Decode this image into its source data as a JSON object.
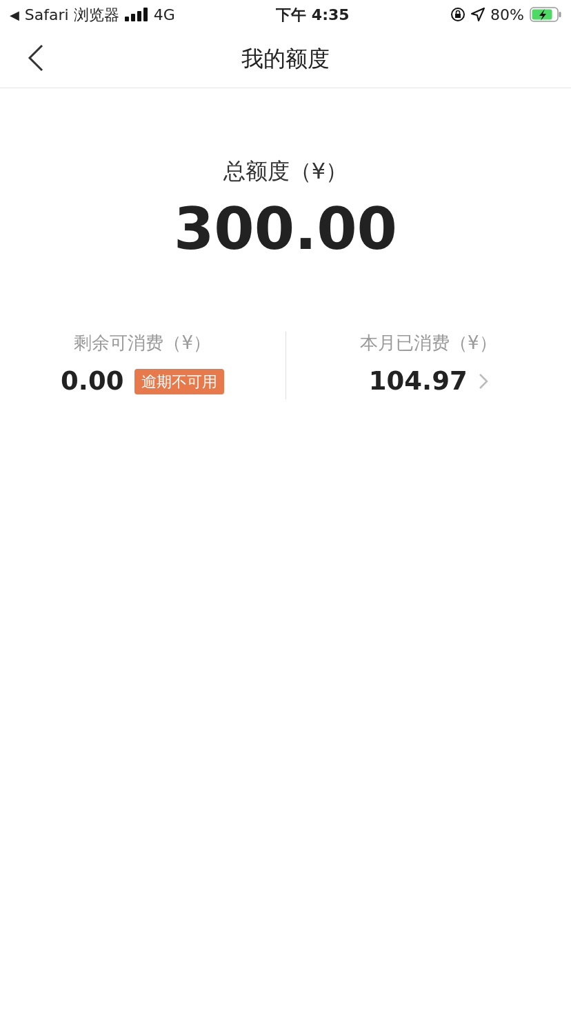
{
  "status_bar": {
    "back_arrow": "◀",
    "back_app": "Safari 浏览器",
    "network": "4G",
    "time": "下午 4:35",
    "battery": "80%",
    "charging": true
  },
  "nav": {
    "title": "我的额度"
  },
  "total": {
    "label": "总额度（¥）",
    "amount": "300.00"
  },
  "stats": [
    {
      "label": "剩余可消费（¥）",
      "amount": "0.00",
      "tag": "逾期不可用",
      "chevron": false
    },
    {
      "label": "本月已消费（¥）",
      "amount": "104.97",
      "chevron": true
    }
  ]
}
